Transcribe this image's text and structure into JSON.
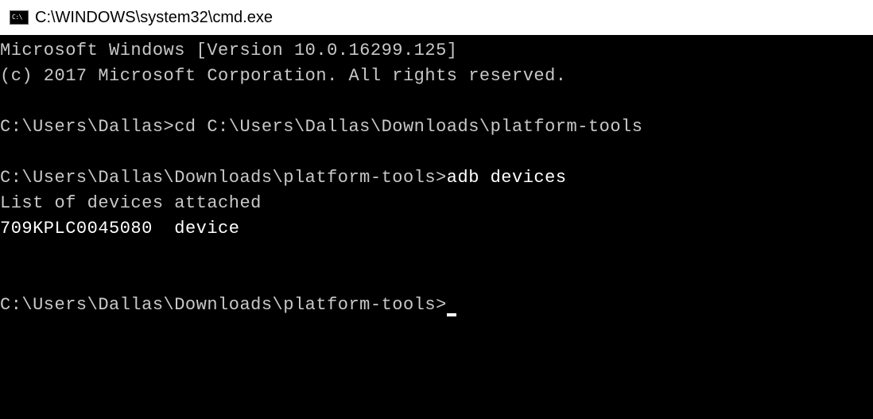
{
  "titlebar": {
    "icon_label": "C:\\",
    "title": "C:\\WINDOWS\\system32\\cmd.exe"
  },
  "terminal": {
    "header_line1": "Microsoft Windows [Version 10.0.16299.125]",
    "header_line2": "(c) 2017 Microsoft Corporation. All rights reserved.",
    "prompt1": "C:\\Users\\Dallas>",
    "command1": "cd C:\\Users\\Dallas\\Downloads\\platform-tools",
    "prompt2": "C:\\Users\\Dallas\\Downloads\\platform-tools>",
    "command2": "adb devices",
    "output_line1": "List of devices attached",
    "output_device_id": "709KPLC0045080",
    "output_device_status": "device",
    "prompt3": "C:\\Users\\Dallas\\Downloads\\platform-tools>"
  }
}
